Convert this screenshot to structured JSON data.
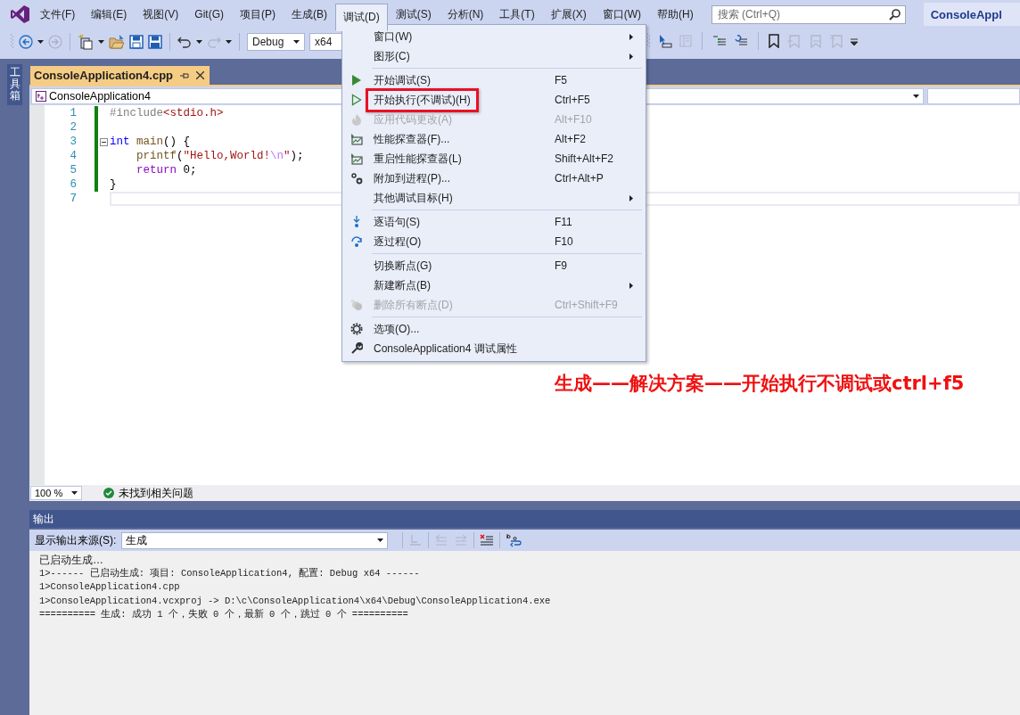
{
  "menubar": {
    "items": [
      {
        "label": "文件(F)",
        "selected": false
      },
      {
        "label": "编辑(E)",
        "selected": false
      },
      {
        "label": "视图(V)",
        "selected": false
      },
      {
        "label": "Git(G)",
        "selected": false
      },
      {
        "label": "项目(P)",
        "selected": false
      },
      {
        "label": "生成(B)",
        "selected": false
      },
      {
        "label": "调试(D)",
        "selected": true
      },
      {
        "label": "测试(S)",
        "selected": false
      },
      {
        "label": "分析(N)",
        "selected": false
      },
      {
        "label": "工具(T)",
        "selected": false
      },
      {
        "label": "扩展(X)",
        "selected": false
      },
      {
        "label": "窗口(W)",
        "selected": false
      },
      {
        "label": "帮助(H)",
        "selected": false
      }
    ],
    "search": {
      "placeholder": "搜索 (Ctrl+Q)"
    },
    "title": "ConsoleAppl"
  },
  "toolbar": {
    "configuration": "Debug",
    "platform": "x64"
  },
  "toolbox": {
    "label": "工具箱"
  },
  "editor": {
    "tab": "ConsoleApplication4.cpp",
    "scope": "ConsoleApplication4",
    "code_lines": [
      {
        "number": "1",
        "changed": true,
        "current": false,
        "collapsible": false,
        "tokens": [
          {
            "kind": "preproc",
            "text": "#include"
          },
          {
            "kind": "string",
            "text": "<stdio.h>"
          }
        ]
      },
      {
        "number": "2",
        "changed": true,
        "current": false,
        "collapsible": false
      },
      {
        "number": "3",
        "changed": true,
        "current": false,
        "collapsible": true,
        "tokens": [
          {
            "kind": "keyword",
            "text": "int "
          },
          {
            "kind": "function",
            "text": "main"
          },
          {
            "kind": "plain",
            "text": "() {"
          }
        ]
      },
      {
        "number": "4",
        "changed": true,
        "current": false,
        "collapsible": false,
        "tokens": [
          {
            "kind": "function",
            "text": "    printf"
          },
          {
            "kind": "plain",
            "text": "("
          },
          {
            "kind": "string",
            "text": "\"Hello,World!"
          },
          {
            "kind": "escape",
            "text": "\\n"
          },
          {
            "kind": "string",
            "text": "\""
          },
          {
            "kind": "plain",
            "text": ");"
          }
        ]
      },
      {
        "number": "5",
        "changed": true,
        "current": false,
        "collapsible": false,
        "tokens": [
          {
            "kind": "control",
            "text": "    return"
          },
          {
            "kind": "plain",
            "text": " 0;"
          }
        ]
      },
      {
        "number": "6",
        "changed": true,
        "current": false,
        "collapsible": false,
        "tokens": [
          {
            "kind": "plain",
            "text": "}"
          }
        ]
      },
      {
        "number": "7",
        "changed": false,
        "current": true,
        "collapsible": false
      }
    ],
    "zoom": "100 %",
    "issues": "未找到相关问题"
  },
  "output": {
    "title": "输出",
    "source_label": "显示输出来源(S):",
    "source": "生成",
    "lines": [
      "已启动生成…",
      "1>------ 已启动生成: 项目: ConsoleApplication4, 配置: Debug x64 ------",
      "1>ConsoleApplication4.cpp",
      "1>ConsoleApplication4.vcxproj -> D:\\c\\ConsoleApplication4\\x64\\Debug\\ConsoleApplication4.exe",
      "========== 生成: 成功 1 个，失败 0 个，最新 0 个，跳过 0 个 =========="
    ]
  },
  "debug_menu": {
    "items": [
      {
        "kind": "item",
        "label": "窗口(W)",
        "submenu": true,
        "disabled": false,
        "highlighted": false
      },
      {
        "kind": "item",
        "label": "图形(C)",
        "submenu": true,
        "disabled": false,
        "highlighted": false
      },
      {
        "kind": "separator"
      },
      {
        "kind": "start",
        "label": "开始调试(S)",
        "shortcut": "F5",
        "submenu": false,
        "disabled": false,
        "highlighted": false
      },
      {
        "kind": "run",
        "label": "开始执行(不调试)(H)",
        "shortcut": "Ctrl+F5",
        "submenu": false,
        "disabled": false,
        "highlighted": true
      },
      {
        "kind": "apply",
        "label": "应用代码更改(A)",
        "shortcut": "Alt+F10",
        "submenu": false,
        "disabled": true,
        "highlighted": false
      },
      {
        "kind": "profiler",
        "label": "性能探查器(F)...",
        "shortcut": "Alt+F2",
        "submenu": false,
        "disabled": false,
        "highlighted": false
      },
      {
        "kind": "profiler",
        "label": "重启性能探查器(L)",
        "shortcut": "Shift+Alt+F2",
        "submenu": false,
        "disabled": false,
        "highlighted": false
      },
      {
        "kind": "attach",
        "label": "附加到进程(P)...",
        "shortcut": "Ctrl+Alt+P",
        "submenu": false,
        "disabled": false,
        "highlighted": false
      },
      {
        "kind": "item",
        "label": "其他调试目标(H)",
        "submenu": true,
        "disabled": false,
        "highlighted": false
      },
      {
        "kind": "separator"
      },
      {
        "kind": "stepinto",
        "label": "逐语句(S)",
        "shortcut": "F11",
        "submenu": false,
        "disabled": false,
        "highlighted": false
      },
      {
        "kind": "stepover",
        "label": "逐过程(O)",
        "shortcut": "F10",
        "submenu": false,
        "disabled": false,
        "highlighted": false
      },
      {
        "kind": "separator"
      },
      {
        "kind": "item",
        "label": "切换断点(G)",
        "shortcut": "F9",
        "submenu": false,
        "disabled": false,
        "highlighted": false
      },
      {
        "kind": "item",
        "label": "新建断点(B)",
        "submenu": true,
        "disabled": false,
        "highlighted": false
      },
      {
        "kind": "breakpoints",
        "label": "删除所有断点(D)",
        "shortcut": "Ctrl+Shift+F9",
        "submenu": false,
        "disabled": true,
        "highlighted": false
      },
      {
        "kind": "separator"
      },
      {
        "kind": "options",
        "label": "选项(O)...",
        "submenu": false,
        "disabled": false,
        "highlighted": false
      },
      {
        "kind": "properties",
        "label": "ConsoleApplication4 调试属性",
        "submenu": false,
        "disabled": false,
        "highlighted": false
      }
    ]
  },
  "annotation": "生成——解决方案——开始执行不调试或ctrl+f5"
}
